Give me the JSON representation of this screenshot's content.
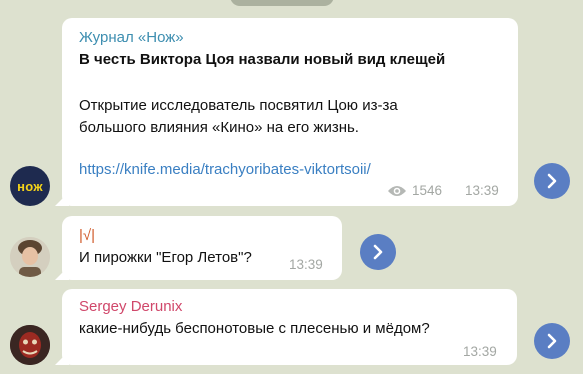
{
  "colors": {
    "background": "#dde1cf",
    "bubble": "#ffffff",
    "link": "#3a7fc2",
    "forward_button": "#5a7ec3",
    "meta_text": "#a3a7a3"
  },
  "messages": [
    {
      "sender": "Журнал «Нож»",
      "sender_color": "#3d8eb0",
      "title": "В честь Виктора Цоя назвали новый вид клещей",
      "body_line1": "Открытие исследователь посвятил Цою из-за",
      "body_line2": "большого влияния «Кино» на его жизнь.",
      "link": "https://knife.media/trachyoribates-viktortsoii/",
      "views": "1546",
      "views_icon": "eye-icon",
      "time": "13:39",
      "avatar_text": "нож",
      "avatar_icon": "channel-logo",
      "action_icon": "forward-icon"
    },
    {
      "sender": "|√|",
      "sender_color": "#d05a2a",
      "text": "И пирожки \"Егор Летов\"?",
      "time": "13:39",
      "avatar_icon": "user-avatar",
      "action_icon": "forward-icon"
    },
    {
      "sender": "Sergey Derunix",
      "sender_color": "#d0476a",
      "text": "какие-нибудь беспонотовые с плесенью и мёдом?",
      "time": "13:39",
      "avatar_icon": "user-avatar",
      "action_icon": "forward-icon"
    }
  ]
}
